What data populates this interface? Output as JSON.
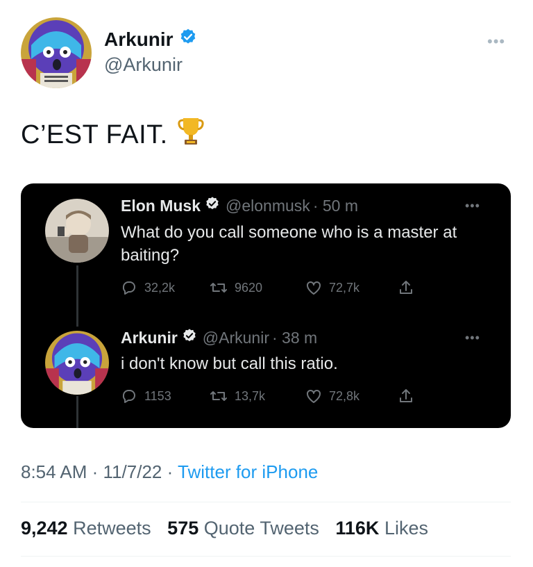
{
  "author": {
    "name": "Arkunir",
    "handle": "@Arkunir",
    "verified": true
  },
  "tweet": {
    "text": "C’EST FAIT.",
    "emoji_icon": "trophy-icon"
  },
  "quoted_thread": [
    {
      "name": "Elon Musk",
      "handle": "@elonmusk",
      "time": "· 50 m",
      "verified": true,
      "text": "What do you call someone who is a master at baiting?",
      "replies": "32,2k",
      "retweets": "9620",
      "likes": "72,7k"
    },
    {
      "name": "Arkunir",
      "handle": "@Arkunir",
      "time": "· 38 m",
      "verified": true,
      "text": "i don't know but call this ratio.",
      "replies": "1153",
      "retweets": "13,7k",
      "likes": "72,8k"
    }
  ],
  "meta": {
    "time": "8:54 AM",
    "date": "11/7/22",
    "separator": "·",
    "source": "Twitter for iPhone"
  },
  "stats": {
    "retweets_count": "9,242",
    "retweets_label": "Retweets",
    "quotes_count": "575",
    "quotes_label": "Quote Tweets",
    "likes_count": "116K",
    "likes_label": "Likes"
  },
  "colors": {
    "accent": "#1d9bf0",
    "verified": "#1d9bf0",
    "dark_bg": "#000000",
    "secondary_text": "#536471"
  }
}
